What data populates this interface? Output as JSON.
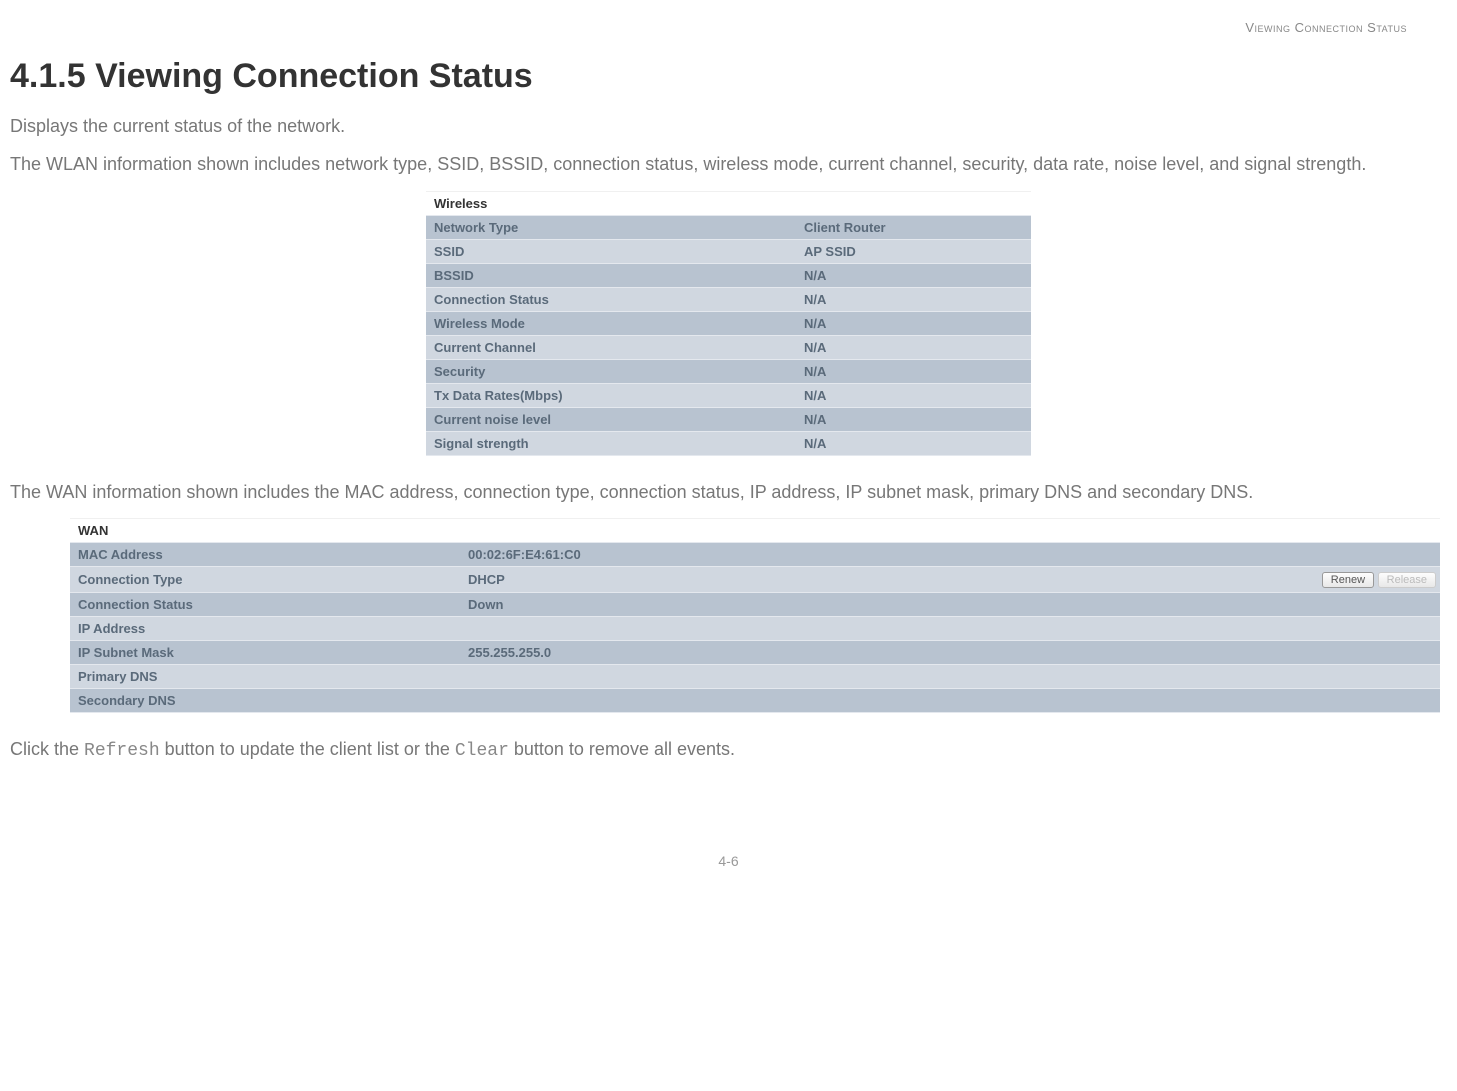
{
  "header": {
    "running_head": "Viewing Connection Status"
  },
  "section": {
    "number": "4.1.5",
    "title": "Viewing Connection Status"
  },
  "paragraphs": {
    "intro": "Displays the current status of the network.",
    "wlan": "The WLAN information shown includes network type, SSID, BSSID, connection status, wireless mode, current channel, security, data rate, noise level, and signal strength.",
    "wan": "The WAN information shown includes the MAC address, connection type, connection status, IP address, IP subnet mask, primary DNS and secondary DNS.",
    "closing_prefix": "Click the ",
    "closing_code1": "Refresh",
    "closing_mid": " button to update the client list or the ",
    "closing_code2": "Clear",
    "closing_suffix": " button to remove all events."
  },
  "wireless_table": {
    "caption": "Wireless",
    "rows": [
      {
        "label": "Network Type",
        "value": "Client Router"
      },
      {
        "label": "SSID",
        "value": "AP SSID"
      },
      {
        "label": "BSSID",
        "value": "N/A"
      },
      {
        "label": "Connection Status",
        "value": "N/A"
      },
      {
        "label": "Wireless Mode",
        "value": "N/A"
      },
      {
        "label": "Current Channel",
        "value": "N/A"
      },
      {
        "label": "Security",
        "value": "N/A"
      },
      {
        "label": "Tx Data Rates(Mbps)",
        "value": "N/A"
      },
      {
        "label": "Current noise level",
        "value": "N/A"
      },
      {
        "label": "Signal strength",
        "value": "N/A"
      }
    ]
  },
  "wan_table": {
    "caption": "WAN",
    "buttons": {
      "renew": "Renew",
      "release": "Release"
    },
    "rows": [
      {
        "label": "MAC Address",
        "value": "00:02:6F:E4:61:C0"
      },
      {
        "label": "Connection Type",
        "value": "DHCP",
        "has_buttons": true
      },
      {
        "label": "Connection Status",
        "value": "Down"
      },
      {
        "label": "IP Address",
        "value": ""
      },
      {
        "label": "IP Subnet Mask",
        "value": "255.255.255.0"
      },
      {
        "label": "Primary DNS",
        "value": ""
      },
      {
        "label": "Secondary DNS",
        "value": ""
      }
    ]
  },
  "page_number": "4-6"
}
